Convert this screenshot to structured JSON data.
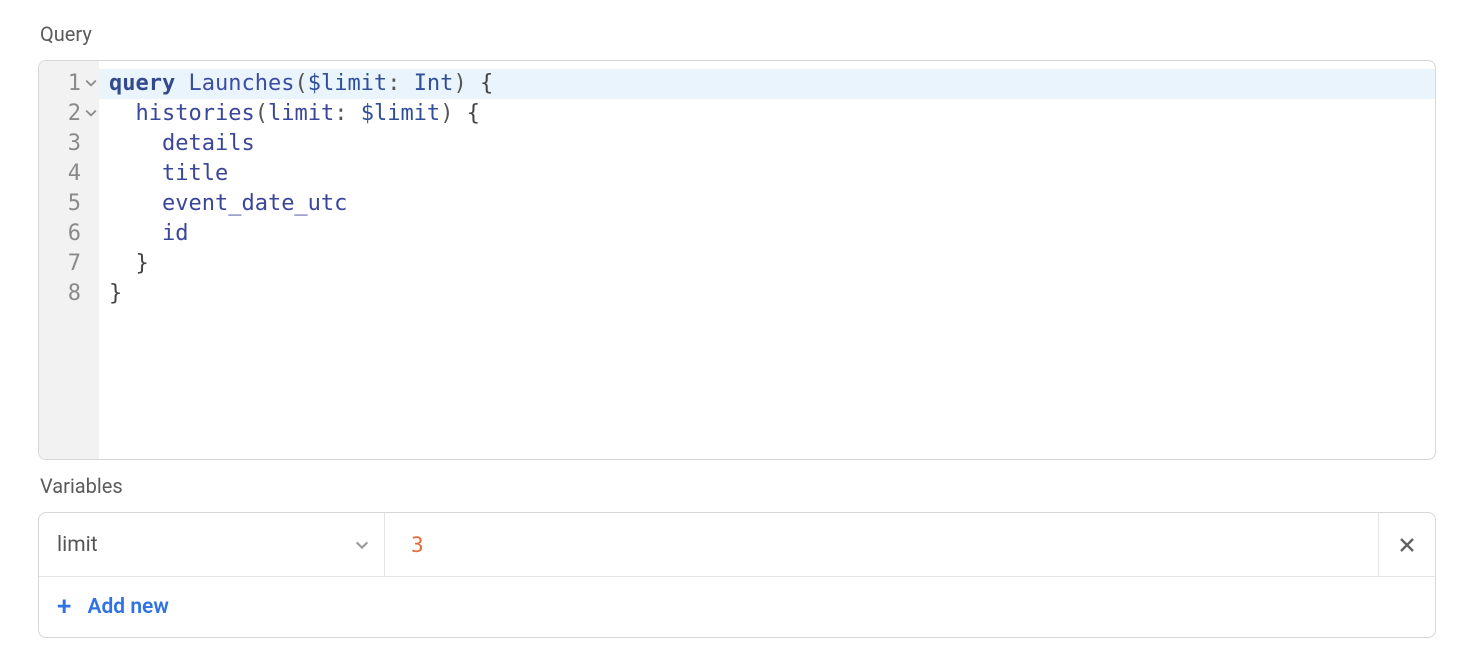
{
  "labels": {
    "query": "Query",
    "variables": "Variables",
    "add_new": "Add new"
  },
  "editor": {
    "lines": [
      {
        "num": "1",
        "foldable": true,
        "highlight": true,
        "tokens": [
          {
            "c": "tok-keyword",
            "t": "query"
          },
          {
            "c": "",
            "t": " "
          },
          {
            "c": "tok-defname",
            "t": "Launches"
          },
          {
            "c": "tok-punc",
            "t": "("
          },
          {
            "c": "tok-var",
            "t": "$limit"
          },
          {
            "c": "tok-punc",
            "t": ": "
          },
          {
            "c": "tok-type",
            "t": "Int"
          },
          {
            "c": "tok-punc",
            "t": ")"
          },
          {
            "c": "",
            "t": " "
          },
          {
            "c": "tok-brace",
            "t": "{"
          }
        ]
      },
      {
        "num": "2",
        "foldable": true,
        "tokens": [
          {
            "c": "",
            "t": "  "
          },
          {
            "c": "tok-field",
            "t": "histories"
          },
          {
            "c": "tok-punc",
            "t": "("
          },
          {
            "c": "tok-field",
            "t": "limit"
          },
          {
            "c": "tok-punc",
            "t": ": "
          },
          {
            "c": "tok-var",
            "t": "$limit"
          },
          {
            "c": "tok-punc",
            "t": ")"
          },
          {
            "c": "",
            "t": " "
          },
          {
            "c": "tok-brace",
            "t": "{"
          }
        ]
      },
      {
        "num": "3",
        "tokens": [
          {
            "c": "",
            "t": "    "
          },
          {
            "c": "tok-field",
            "t": "details"
          }
        ]
      },
      {
        "num": "4",
        "tokens": [
          {
            "c": "",
            "t": "    "
          },
          {
            "c": "tok-field",
            "t": "title"
          }
        ]
      },
      {
        "num": "5",
        "tokens": [
          {
            "c": "",
            "t": "    "
          },
          {
            "c": "tok-field",
            "t": "event_date_utc"
          }
        ]
      },
      {
        "num": "6",
        "tokens": [
          {
            "c": "",
            "t": "    "
          },
          {
            "c": "tok-field",
            "t": "id"
          }
        ]
      },
      {
        "num": "7",
        "tokens": [
          {
            "c": "",
            "t": "  "
          },
          {
            "c": "tok-brace",
            "t": "}"
          }
        ]
      },
      {
        "num": "8",
        "tokens": [
          {
            "c": "tok-brace",
            "t": "}"
          }
        ]
      }
    ]
  },
  "variables": {
    "rows": [
      {
        "key": "limit",
        "value": "3"
      }
    ]
  }
}
